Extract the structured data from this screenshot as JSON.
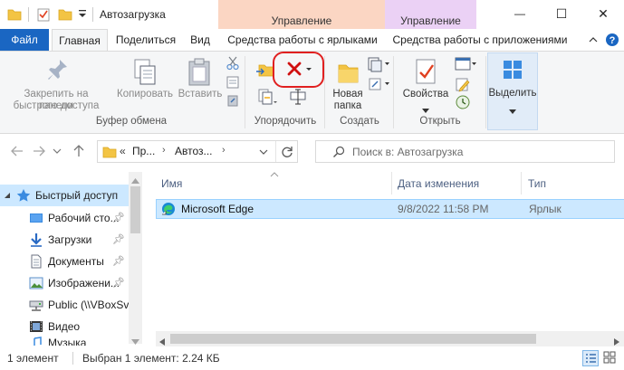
{
  "window": {
    "title": "Автозагрузка",
    "context_tabs": [
      {
        "label": "Управление",
        "color": "#fbd6c3"
      },
      {
        "label": "Управление",
        "color": "#ebd1f5"
      }
    ],
    "controls": {
      "minimize": "—",
      "maximize": "☐",
      "close": "✕"
    }
  },
  "ribbon_tabs": {
    "file": "Файл",
    "home": "Главная",
    "share": "Поделиться",
    "view": "Вид",
    "shortcut_tools": "Средства работы с ярлыками",
    "app_tools": "Средства работы с приложениями"
  },
  "ribbon": {
    "clipboard": {
      "pin_line1": "Закрепить на панели",
      "pin_line2": "быстрого доступа",
      "copy": "Копировать",
      "paste": "Вставить",
      "group": "Буфер обмена"
    },
    "organize": {
      "group": "Упорядочить"
    },
    "create": {
      "new_folder_line1": "Новая",
      "new_folder_line2": "папка",
      "group": "Создать"
    },
    "open": {
      "properties": "Свойства",
      "group": "Открыть"
    },
    "select": {
      "label": "Выделить"
    }
  },
  "address": {
    "overflow": "«",
    "crumb1": "Пр...",
    "crumb2": "Автоз...",
    "search_placeholder": "Поиск в: Автозагрузка"
  },
  "nav": {
    "items": [
      {
        "label": "Быстрый доступ"
      },
      {
        "label": "Рабочий сто..."
      },
      {
        "label": "Загрузки"
      },
      {
        "label": "Документы"
      },
      {
        "label": "Изображени..."
      },
      {
        "label": "Public (\\\\VBoxSv..."
      },
      {
        "label": "Видео"
      },
      {
        "label": "Музыка"
      }
    ]
  },
  "file_list": {
    "columns": {
      "name": "Имя",
      "date": "Дата изменения",
      "type": "Тип"
    },
    "rows": [
      {
        "name": "Microsoft Edge",
        "date": "9/8/2022 11:58 PM",
        "type": "Ярлык"
      }
    ]
  },
  "status": {
    "count": "1 элемент",
    "selected": "Выбран 1 элемент: 2.24 КБ"
  },
  "colors": {
    "accent": "#1a66c2",
    "selection": "#cce8ff",
    "highlight_ring": "#e02020",
    "delete_x": "#d01010"
  }
}
